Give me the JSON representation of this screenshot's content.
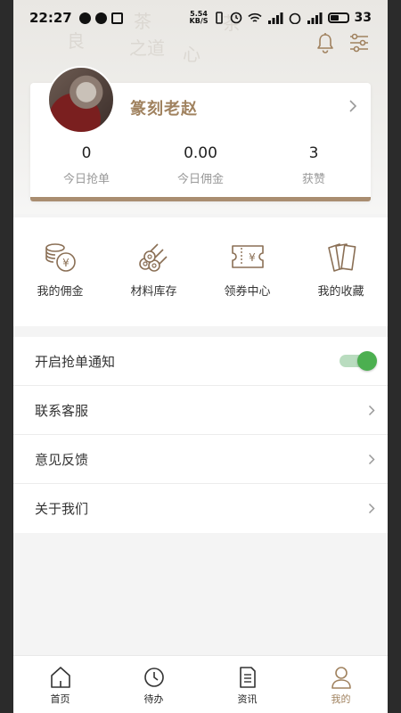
{
  "status_bar": {
    "time": "22:27",
    "net_speed_top": "5.54",
    "net_speed_bottom": "KB/S",
    "battery": "33"
  },
  "profile": {
    "name": "篆刻老赵"
  },
  "stats": [
    {
      "value": "0",
      "label": "今日抢单"
    },
    {
      "value": "0.00",
      "label": "今日佣金"
    },
    {
      "value": "3",
      "label": "获赞"
    }
  ],
  "actions": [
    {
      "label": "我的佣金",
      "icon": "coins-icon"
    },
    {
      "label": "材料库存",
      "icon": "logs-stack-icon"
    },
    {
      "label": "领券中心",
      "icon": "coupon-icon"
    },
    {
      "label": "我的收藏",
      "icon": "cards-icon"
    }
  ],
  "settings": {
    "notify_label": "开启抢单通知",
    "notify_enabled": true,
    "support_label": "联系客服",
    "feedback_label": "意见反馈",
    "about_label": "关于我们"
  },
  "tabs": [
    {
      "label": "首页",
      "icon": "home-icon"
    },
    {
      "label": "待办",
      "icon": "clock-icon"
    },
    {
      "label": "资讯",
      "icon": "document-icon"
    },
    {
      "label": "我的",
      "icon": "person-icon",
      "active": true
    }
  ],
  "colors": {
    "accent": "#a0825f",
    "toggle_on": "#4caf50",
    "card_bar": "#a98d70"
  }
}
